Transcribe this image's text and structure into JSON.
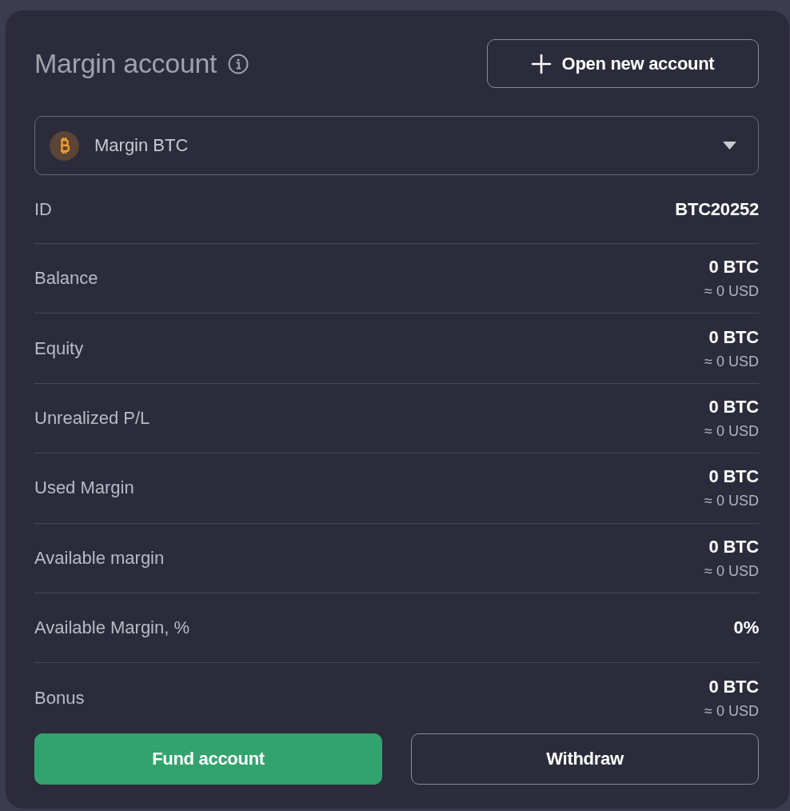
{
  "header": {
    "title": "Margin account",
    "action": {
      "label": "Open new account"
    }
  },
  "account_select": {
    "value": "Margin BTC"
  },
  "details": [
    {
      "label": "ID",
      "value": "BTC20252"
    },
    {
      "label": "Balance",
      "value": "0 BTC",
      "secondary": "≈ 0 USD"
    },
    {
      "label": "Equity",
      "value": "0 BTC",
      "secondary": "≈ 0 USD"
    },
    {
      "label": "Unrealized P/L",
      "value": "0 BTC",
      "secondary": "≈ 0 USD"
    },
    {
      "label": "Used Margin",
      "value": "0 BTC",
      "secondary": "≈ 0 USD"
    },
    {
      "label": "Available margin",
      "value": "0 BTC",
      "secondary": "≈ 0 USD"
    },
    {
      "label": "Available Margin, %",
      "value": "0%"
    },
    {
      "label": "Bonus",
      "value": "0 BTC",
      "secondary": "≈ 0 USD"
    }
  ],
  "buttons": [
    {
      "label": "Fund account",
      "kind": "primary"
    },
    {
      "label": "Withdraw",
      "kind": "secondary"
    }
  ]
}
